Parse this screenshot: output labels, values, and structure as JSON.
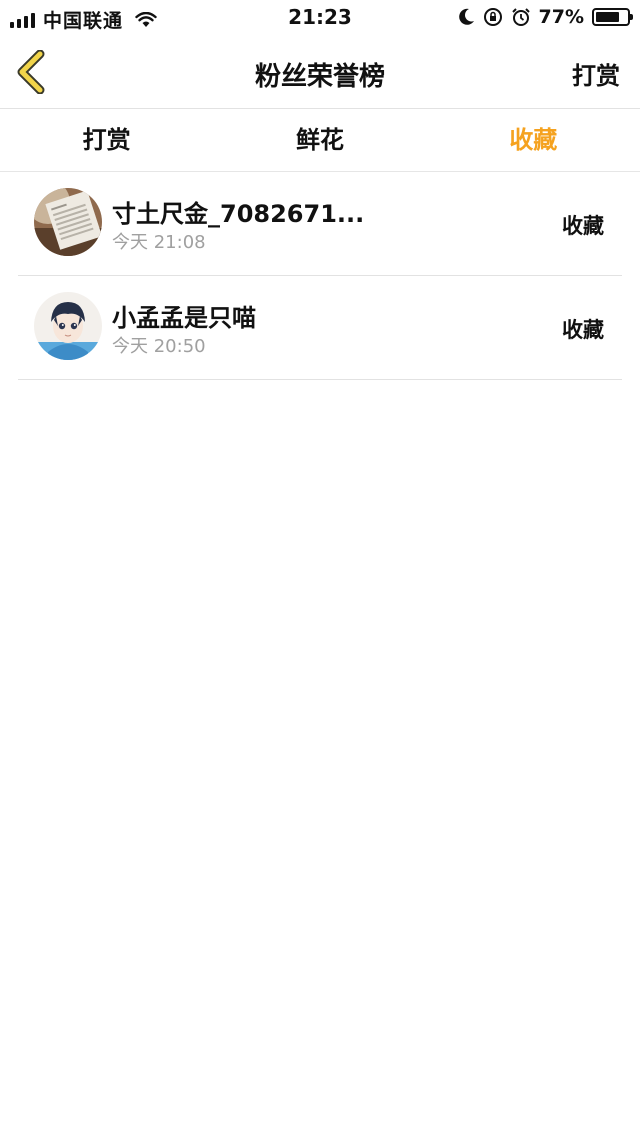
{
  "status_bar": {
    "carrier": "中国联通",
    "time": "21:23",
    "battery": "77%",
    "battery_level": 0.77
  },
  "nav": {
    "title": "粉丝荣誉榜",
    "action": "打赏",
    "back_icon": "chevron-left-icon",
    "accent": "#f5a21f"
  },
  "tabs": [
    {
      "label": "打赏",
      "active": false
    },
    {
      "label": "鲜花",
      "active": false
    },
    {
      "label": "收藏",
      "active": true
    }
  ],
  "list": [
    {
      "name": "寸土尺金_7082671...",
      "time": "今天 21:08",
      "action": "收藏",
      "avatar": "newspaper-avatar"
    },
    {
      "name": "小孟孟是只喵",
      "time": "今天 20:50",
      "action": "收藏",
      "avatar": "anime-boy-avatar"
    }
  ]
}
